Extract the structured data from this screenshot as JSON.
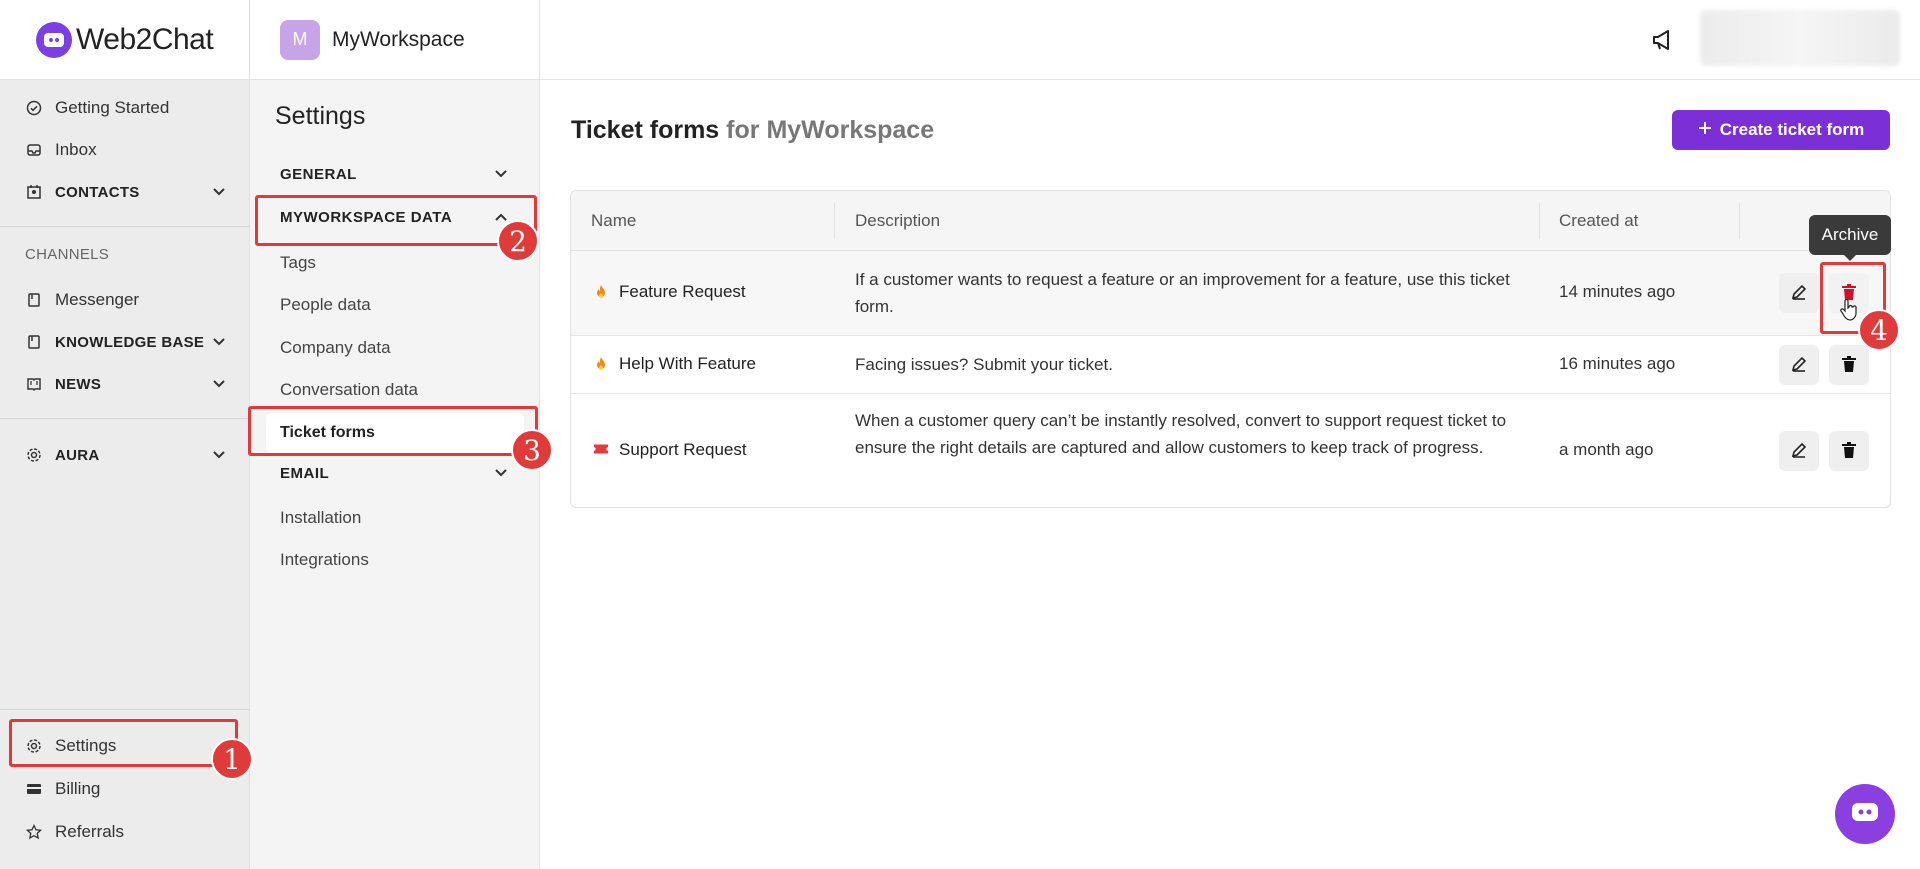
{
  "brand": {
    "name": "Web2Chat",
    "accent": "#7b2fd6"
  },
  "leftnav": {
    "items": [
      {
        "label": "Getting Started",
        "icon": "check-circle-icon"
      },
      {
        "label": "Inbox",
        "icon": "inbox-icon"
      },
      {
        "label": "CONTACTS",
        "icon": "contacts-icon"
      }
    ],
    "channels_caption": "CHANNELS",
    "channel_items": [
      {
        "label": "Messenger",
        "icon": "messenger-icon"
      },
      {
        "label": "KNOWLEDGE BASE",
        "icon": "book-icon"
      },
      {
        "label": "NEWS",
        "icon": "news-icon"
      }
    ],
    "aura": {
      "label": "AURA",
      "icon": "gear-icon"
    },
    "bottom": [
      {
        "label": "Settings",
        "icon": "gear-icon"
      },
      {
        "label": "Billing",
        "icon": "credit-card-icon"
      },
      {
        "label": "Referrals",
        "icon": "star-icon"
      }
    ]
  },
  "workspace": {
    "avatar": "M",
    "name": "MyWorkspace"
  },
  "settings_nav": {
    "title": "Settings",
    "sections": {
      "general": "GENERAL",
      "data": "MYWORKSPACE DATA",
      "email": "EMAIL"
    },
    "data_items": [
      "Tags",
      "People data",
      "Company data",
      "Conversation data",
      "Ticket forms"
    ],
    "other_items": [
      "Installation",
      "Integrations"
    ]
  },
  "main": {
    "title": "Ticket forms",
    "title_suffix": "for MyWorkspace",
    "create_button": "Create ticket form",
    "columns": [
      "Name",
      "Description",
      "Created at"
    ],
    "rows": [
      {
        "emoji": "fire-icon",
        "name": "Feature Request",
        "description": "If a customer wants to request a feature or an improvement for a feature, use this ticket form.",
        "created": "14 minutes ago"
      },
      {
        "emoji": "fire-icon",
        "name": "Help With Feature",
        "description": "Facing issues? Submit your ticket.",
        "created": "16 minutes ago"
      },
      {
        "emoji": "ticket-icon",
        "name": "Support Request",
        "description": "When a customer query can’t be instantly resolved, convert to support request ticket to ensure the right details are captured and allow customers to keep track of progress.",
        "created": "a month ago"
      }
    ],
    "tooltip": "Archive"
  },
  "annotations": [
    "1",
    "2",
    "3",
    "4"
  ]
}
